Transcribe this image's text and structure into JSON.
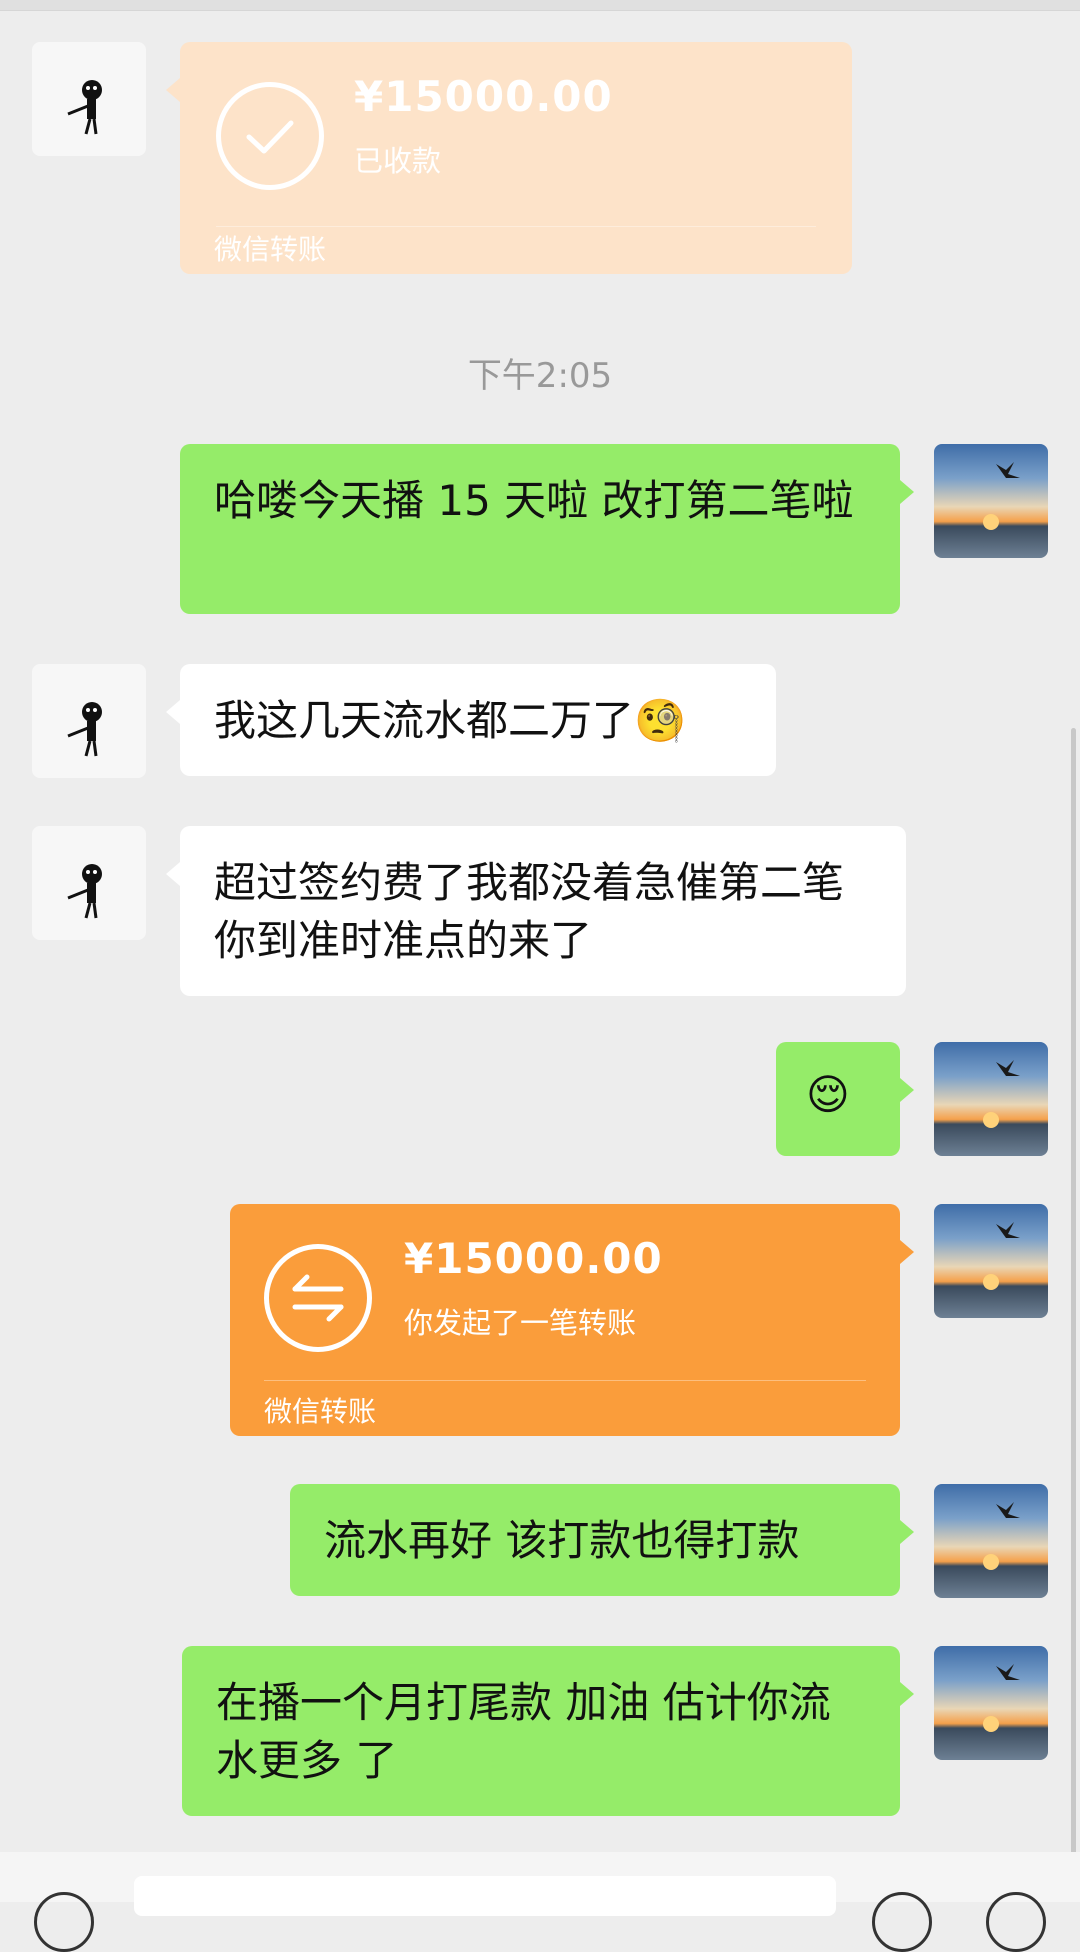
{
  "timestamp": "下午2:05",
  "messages": {
    "received_transfer": {
      "amount": "¥15000.00",
      "status": "已收款",
      "brand": "微信转账"
    },
    "m1": "哈喽今天播 15 天啦 改打第二笔啦",
    "m2": "我这几天流水都二万了🧐",
    "m3": "超过签约费了我都没着急催第二笔你到准时准点的来了",
    "m4": "😌",
    "sent_transfer": {
      "amount": "¥15000.00",
      "status": "你发起了一笔转账",
      "brand": "微信转账"
    },
    "m5": "流水再好 该打款也得打款",
    "m6": "在播一个月打尾款 加油  估计你流水更多 了"
  },
  "colors": {
    "background": "#ededed",
    "bubble_green": "#95ec69",
    "bubble_white": "#ffffff",
    "transfer_received": "#fde3c9",
    "transfer_sent": "#fa9d3b"
  },
  "icons": [
    "check-circle-icon",
    "transfer-arrows-icon",
    "voice-icon",
    "emoji-icon",
    "add-icon"
  ]
}
